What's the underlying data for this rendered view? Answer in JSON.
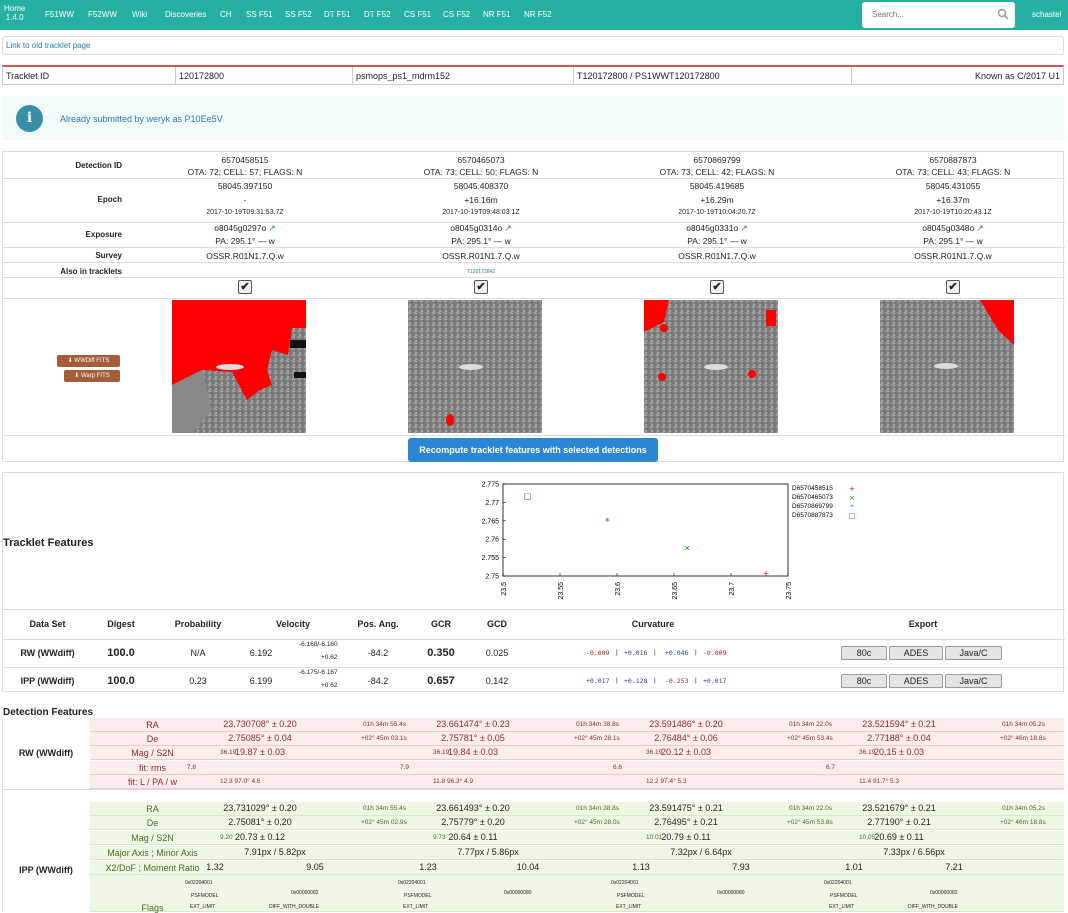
{
  "nav": {
    "home_label": "Home",
    "version": "1.4.0",
    "items": [
      "F51WW",
      "F52WW",
      "Wiki",
      "Discoveries",
      "CH",
      "SS F51",
      "SS F52",
      "DT F51",
      "DT F52",
      "CS F51",
      "CS F52",
      "NR F51",
      "NR F52"
    ],
    "search_placeholder": "Search...",
    "user": "schastel"
  },
  "old_link": "Link to old tracklet page",
  "tracklet": {
    "label": "Tracklet ID",
    "id": "120172800",
    "source": "psmops_ps1_mdrm152",
    "designation": "T120172800 / PS1WWT120172800",
    "known_as": "Known as C/2017 U1"
  },
  "alert": {
    "message": "Already submitted by weryk as P10Ee5V"
  },
  "detections": {
    "labels": {
      "detection_id": "Detection ID",
      "epoch": "Epoch",
      "exposure": "Exposure",
      "survey": "Survey",
      "also_in": "Also in tracklets"
    },
    "columns": [
      {
        "id": "6570458515",
        "ota": "OTA: 72; CELL: 57; FLAGS: N",
        "mjd": "58045.397150",
        "dt": "-",
        "utc": "2017-10-19T09:31:53.7Z",
        "exposure": "o8045g0297o",
        "pa": "PA: 295.1° — w",
        "survey": "OSSR.R01N1.7.Q.w",
        "also": ""
      },
      {
        "id": "6570465073",
        "ota": "OTA: 73; CELL: 50; FLAGS: N",
        "mjd": "58045.408370",
        "dt": "+16.16m",
        "utc": "2017-10-19T09:48:03.1Z",
        "exposure": "o8045g0314o",
        "pa": "PA: 295.1° — w",
        "survey": "OSSR.R01N1.7.Q.w",
        "also": "T120173842"
      },
      {
        "id": "6570869799",
        "ota": "OTA: 73; CELL: 42; FLAGS: N",
        "mjd": "58045.419685",
        "dt": "+16.29m",
        "utc": "2017-10-19T10:04:20.7Z",
        "exposure": "o8045g0331o",
        "pa": "PA: 295.1° — w",
        "survey": "OSSR.R01N1.7.Q.w",
        "also": ""
      },
      {
        "id": "6570887873",
        "ota": "OTA: 73; CELL: 43; FLAGS: N",
        "mjd": "58045.431055",
        "dt": "+16.37m",
        "utc": "2017-10-19T10:20:43.1Z",
        "exposure": "o8045g0348o",
        "pa": "PA: 295.1° — w",
        "survey": "OSSR.R01N1.7.Q.w",
        "also": ""
      }
    ],
    "wwdiff_btn": "WWDiff FITS",
    "warp_btn": "Warp FITS",
    "recompute_btn": "Recompute tracklet features with selected detections"
  },
  "tracklet_features": {
    "title": "Tracklet Features",
    "headers": [
      "Data Set",
      "Digest",
      "Probability",
      "Velocity",
      "Pos. Ang.",
      "GCR",
      "GCD",
      "Curvature",
      "Export"
    ],
    "rows": [
      {
        "set": "RW (WWdiff)",
        "digest": "100.0",
        "prob": "N/A",
        "vel": "6.192",
        "vel_a": "-6.168/-6.160",
        "vel_b": "+0.62",
        "pa": "-84.2",
        "gcr": "0.350",
        "gcd": "0.025",
        "curv": [
          "-0.009",
          "+0.016",
          "+0.046",
          "-0.009"
        ]
      },
      {
        "set": "IPP (WWdiff)",
        "digest": "100.0",
        "prob": "0.23",
        "vel": "6.199",
        "vel_a": "-6.175/-6.167",
        "vel_b": "+0.62",
        "pa": "-84.2",
        "gcr": "0.657",
        "gcd": "0.142",
        "curv": [
          "+0.017",
          "+0.128",
          "-0.253",
          "+0.017"
        ]
      }
    ],
    "export_buttons": [
      "80c",
      "ADES",
      "Java/C"
    ]
  },
  "chart_data": {
    "type": "scatter",
    "title": "",
    "xlabel": "",
    "ylabel": "",
    "xlim": [
      23.5,
      23.75
    ],
    "ylim": [
      2.75,
      2.775
    ],
    "xticks": [
      "23.5",
      "23.55",
      "23.6",
      "23.65",
      "23.7",
      "23.75"
    ],
    "yticks": [
      "2.775",
      "2.77",
      "2.765",
      "2.76",
      "2.755",
      "2.75"
    ],
    "legend_position": "right",
    "series": [
      {
        "name": "D6570458515",
        "marker": "+",
        "color": "#e00000",
        "x": [
          23.7307
        ],
        "y": [
          2.7508
        ]
      },
      {
        "name": "D6570465073",
        "marker": "×",
        "color": "#00a000",
        "x": [
          23.6615
        ],
        "y": [
          2.7578
        ]
      },
      {
        "name": "D6570869799",
        "marker": "*",
        "color": "#1e6fd0",
        "x": [
          23.5915
        ],
        "y": [
          2.7648
        ]
      },
      {
        "name": "D6570887873",
        "marker": "□",
        "color": "#c000c0",
        "x": [
          23.5216
        ],
        "y": [
          2.7719
        ]
      }
    ]
  },
  "detection_features": {
    "title": "Detection Features",
    "rw": {
      "set": "RW (WWdiff)",
      "labels": {
        "ra": "RA",
        "de": "De",
        "mag": "Mag / S2N",
        "fit_rms": "fit: rms",
        "fit_lpaw": "fit: L / PA / w"
      },
      "cols": [
        {
          "ra": "23.730708° ± 0.20",
          "ra_hms": "01h 34m 55.4s",
          "de": "2.75085° ± 0.04",
          "de_dms": "+02° 45m 03.1s",
          "mag": "19.87 ± 0.03",
          "s2n": "36.19",
          "rms": "7.8",
          "lpaw": "12.3  97.0°  4.6"
        },
        {
          "ra": "23.661474° ± 0.23",
          "ra_hms": "01h 34m 38.8s",
          "de": "2.75781° ± 0.05",
          "de_dms": "+02° 45m 28.1s",
          "mag": "19.84 ± 0.03",
          "s2n": "36.19",
          "rms": "7.9",
          "lpaw": "11.8  96.3°  4.9"
        },
        {
          "ra": "23.591486° ± 0.20",
          "ra_hms": "01h 34m 22.0s",
          "de": "2.76484° ± 0.06",
          "de_dms": "+02° 45m 53.4s",
          "mag": "20.12 ± 0.03",
          "s2n": "36.19",
          "rms": "6.6",
          "lpaw": "12.2  97.4°  5.3"
        },
        {
          "ra": "23.521594° ± 0.21",
          "ra_hms": "01h 34m 05.2s",
          "de": "2.77188° ± 0.04",
          "de_dms": "+02° 46m 18.8s",
          "mag": "20.15 ± 0.03",
          "s2n": "36.19",
          "rms": "6.7",
          "lpaw": "11.4  91.7°  5.3"
        }
      ]
    },
    "ipp": {
      "set": "IPP (WWdiff)",
      "labels": {
        "ra": "RA",
        "de": "De",
        "mag": "Mag / S2N",
        "axis": "Major Axis ; Minor Axis",
        "x2": "X2/DoF ; Moment Ratio",
        "flags": "Flags"
      },
      "cols": [
        {
          "ra": "23.731029° ± 0.20",
          "ra_hms": "01h 34m 55.4s",
          "de": "2.75081° ± 0.20",
          "de_dms": "+02° 45m 02.9s",
          "mag": "20.73 ± 0.12",
          "s2n": "9.20",
          "axis": "7.91px / 5.82px",
          "x2": "1.32",
          "mr": "9.05",
          "flag1": "0x02204001",
          "flag1b": "PSFMODEL",
          "flag1c": "EXT_LIMIT",
          "flag2": "0x00000082",
          "flag2b": "DIFF_WITH_DOUBLE"
        },
        {
          "ra": "23.661493° ± 0.20",
          "ra_hms": "01h 34m 38.8s",
          "de": "2.75779° ± 0.20",
          "de_dms": "+02° 45m 28.0s",
          "mag": "20.64 ± 0.11",
          "s2n": "9.73",
          "axis": "7.77px / 5.86px",
          "x2": "1.23",
          "mr": "10.04",
          "flag1": "0x02204001",
          "flag1b": "PSFMODEL",
          "flag1c": "EXT_LIMIT",
          "flag2": "0x00000080",
          "flag2b": ""
        },
        {
          "ra": "23.591475° ± 0.21",
          "ra_hms": "01h 34m 22.0s",
          "de": "2.76495° ± 0.21",
          "de_dms": "+02° 45m 53.8s",
          "mag": "20.79 ± 0.11",
          "s2n": "10.01",
          "axis": "7.32px / 6.64px",
          "x2": "1.13",
          "mr": "7.93",
          "flag1": "0x02204001",
          "flag1b": "PSFMODEL",
          "flag1c": "EXT_LIMIT",
          "flag2": "0x00000080",
          "flag2b": ""
        },
        {
          "ra": "23.521679° ± 0.21",
          "ra_hms": "01h 34m 05.2s",
          "de": "2.77190° ± 0.21",
          "de_dms": "+02° 46m 18.8s",
          "mag": "20.69 ± 0.11",
          "s2n": "10.05",
          "axis": "7.33px / 6.56px",
          "x2": "1.01",
          "mr": "7.21",
          "flag1": "0x02204001",
          "flag1b": "PSFMODEL",
          "flag1c": "EXT_LIMIT",
          "flag2": "0x00000082",
          "flag2b": "DIFF_WITH_DOUBLE"
        }
      ]
    }
  }
}
